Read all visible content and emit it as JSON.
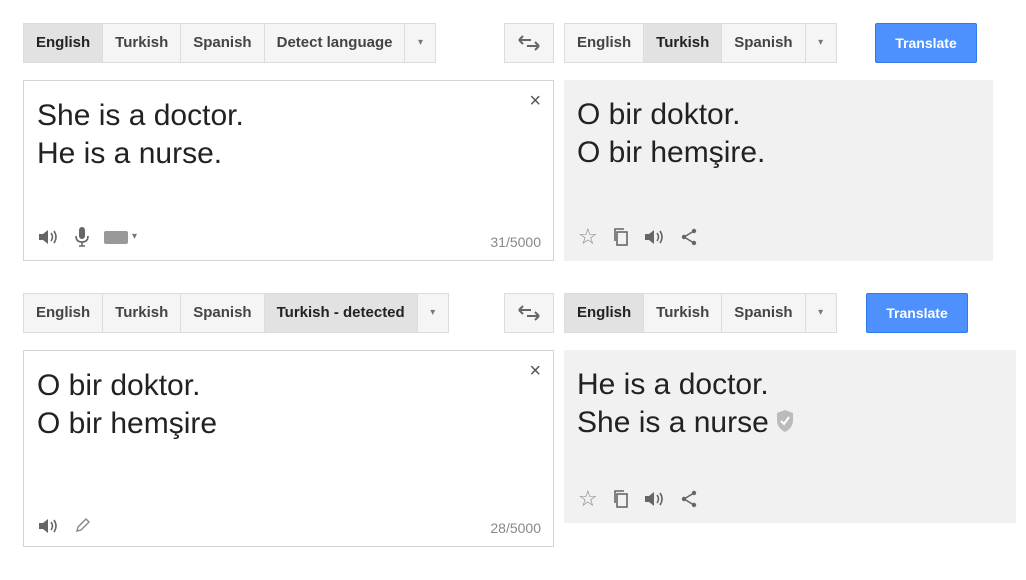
{
  "panels": [
    {
      "source_langs": [
        "English",
        "Turkish",
        "Spanish",
        "Detect language"
      ],
      "source_active": 0,
      "target_langs": [
        "English",
        "Turkish",
        "Spanish"
      ],
      "target_active": 1,
      "translate_label": "Translate",
      "input_lines": [
        "She is a doctor.",
        "He is a nurse."
      ],
      "output_lines": [
        "O bir doktor.",
        "O bir hemşire."
      ],
      "char_count": "31/5000",
      "clear_symbol": "×"
    },
    {
      "source_langs": [
        "English",
        "Turkish",
        "Spanish",
        "Turkish - detected"
      ],
      "source_active": 3,
      "target_langs": [
        "English",
        "Turkish",
        "Spanish"
      ],
      "target_active": 0,
      "translate_label": "Translate",
      "input_lines": [
        "O bir doktor.",
        "O bir hemşire"
      ],
      "output_lines": [
        "He is a doctor.",
        "She is a nurse"
      ],
      "char_count": "28/5000",
      "clear_symbol": "×"
    }
  ],
  "colors": {
    "translate_button": "#4d90fe",
    "active_tab": "#e2e2e2",
    "output_background": "#f1f1f1"
  },
  "icons": {
    "source_tools_panel1": [
      "speaker-icon",
      "microphone-icon",
      "keyboard-icon"
    ],
    "source_tools_panel2": [
      "speaker-icon",
      "pencil-icon"
    ],
    "output_tools": [
      "star-icon",
      "copy-icon",
      "speaker-icon",
      "share-icon"
    ],
    "verified": "shield-icon"
  }
}
